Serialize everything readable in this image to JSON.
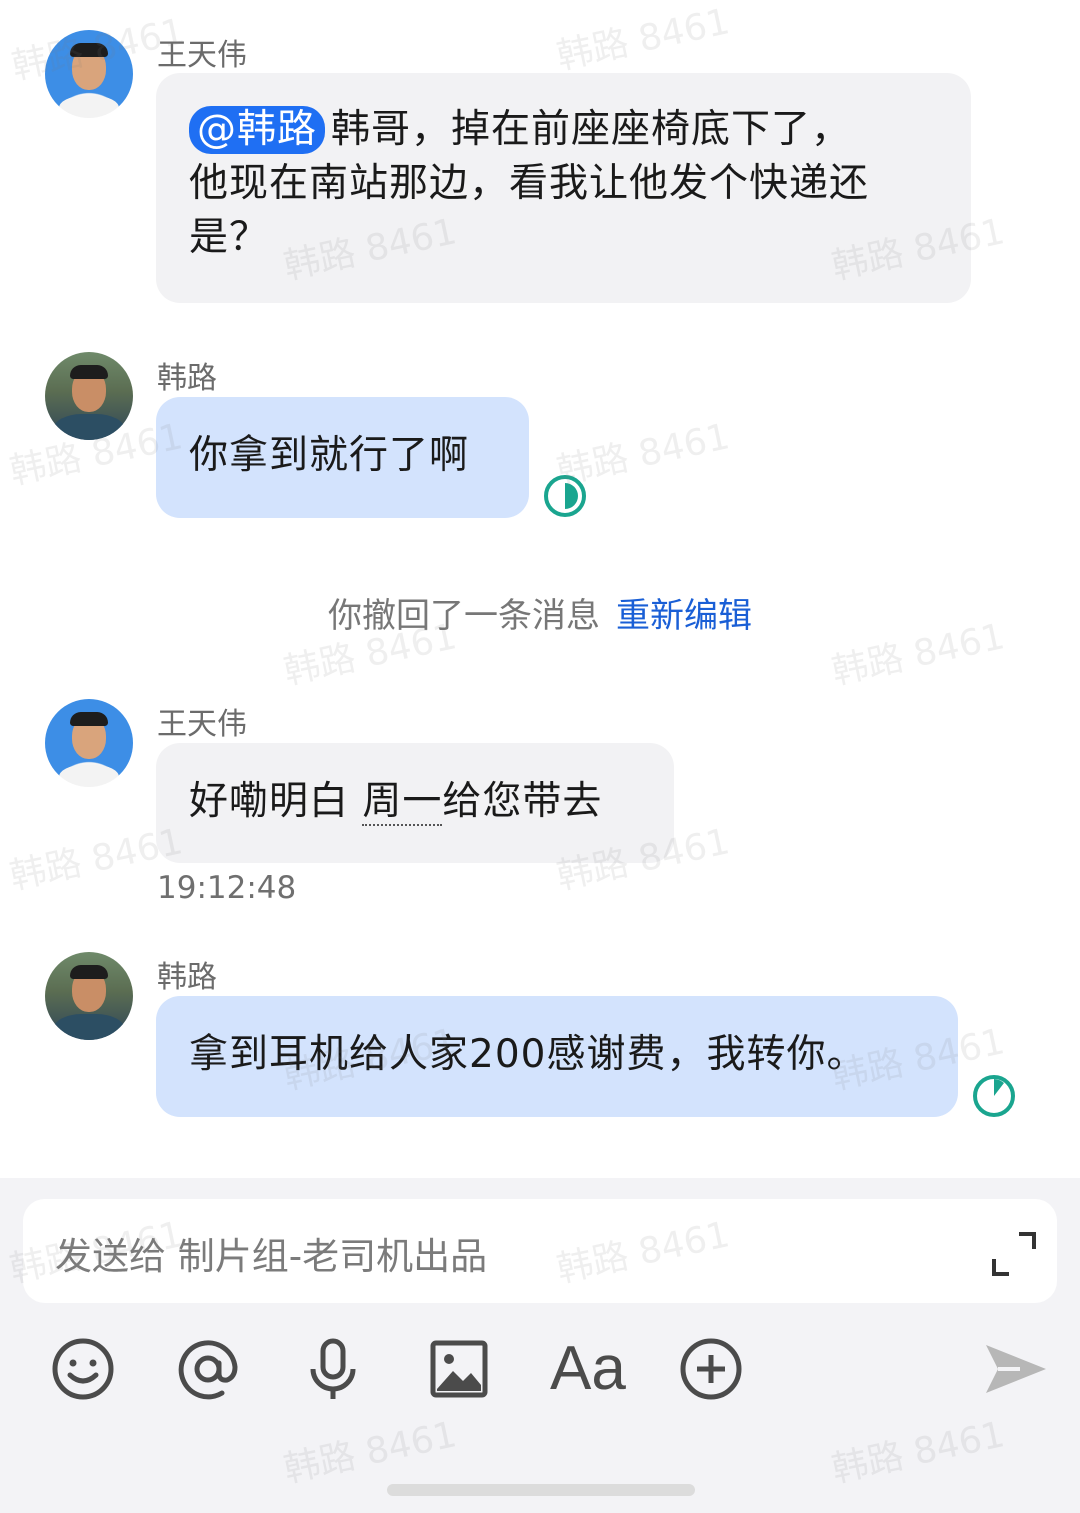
{
  "messages": [
    {
      "sender": "王天伟",
      "mention": "@韩路",
      "text_line1": "韩哥，掉在前座座椅底下了，",
      "text_line2": "他现在南站那边，看我让他发个快递还",
      "text_line3": "是？"
    },
    {
      "sender": "韩路",
      "text": "你拿到就行了啊"
    },
    {
      "sender": "王天伟",
      "text_main": "好嘞明白 ",
      "text_underlined": "周一",
      "text_tail": "给您带去",
      "time": "19:12:48"
    },
    {
      "sender": "韩路",
      "text": "拿到耳机给人家200感谢费，我转你。"
    }
  ],
  "recall": {
    "text": "你撤回了一条消息",
    "link": "重新编辑"
  },
  "input": {
    "placeholder": "发送给 制片组-老司机出品"
  },
  "toolbar": {
    "text_format_label": "Aa"
  },
  "watermark": "韩路 8461",
  "colors": {
    "mention_bg": "#1f6ff3",
    "blue_bubble": "#d3e3fd",
    "gray_bubble": "#f2f2f4",
    "read_green": "#1aa58f",
    "link_blue": "#1a5fd6"
  }
}
